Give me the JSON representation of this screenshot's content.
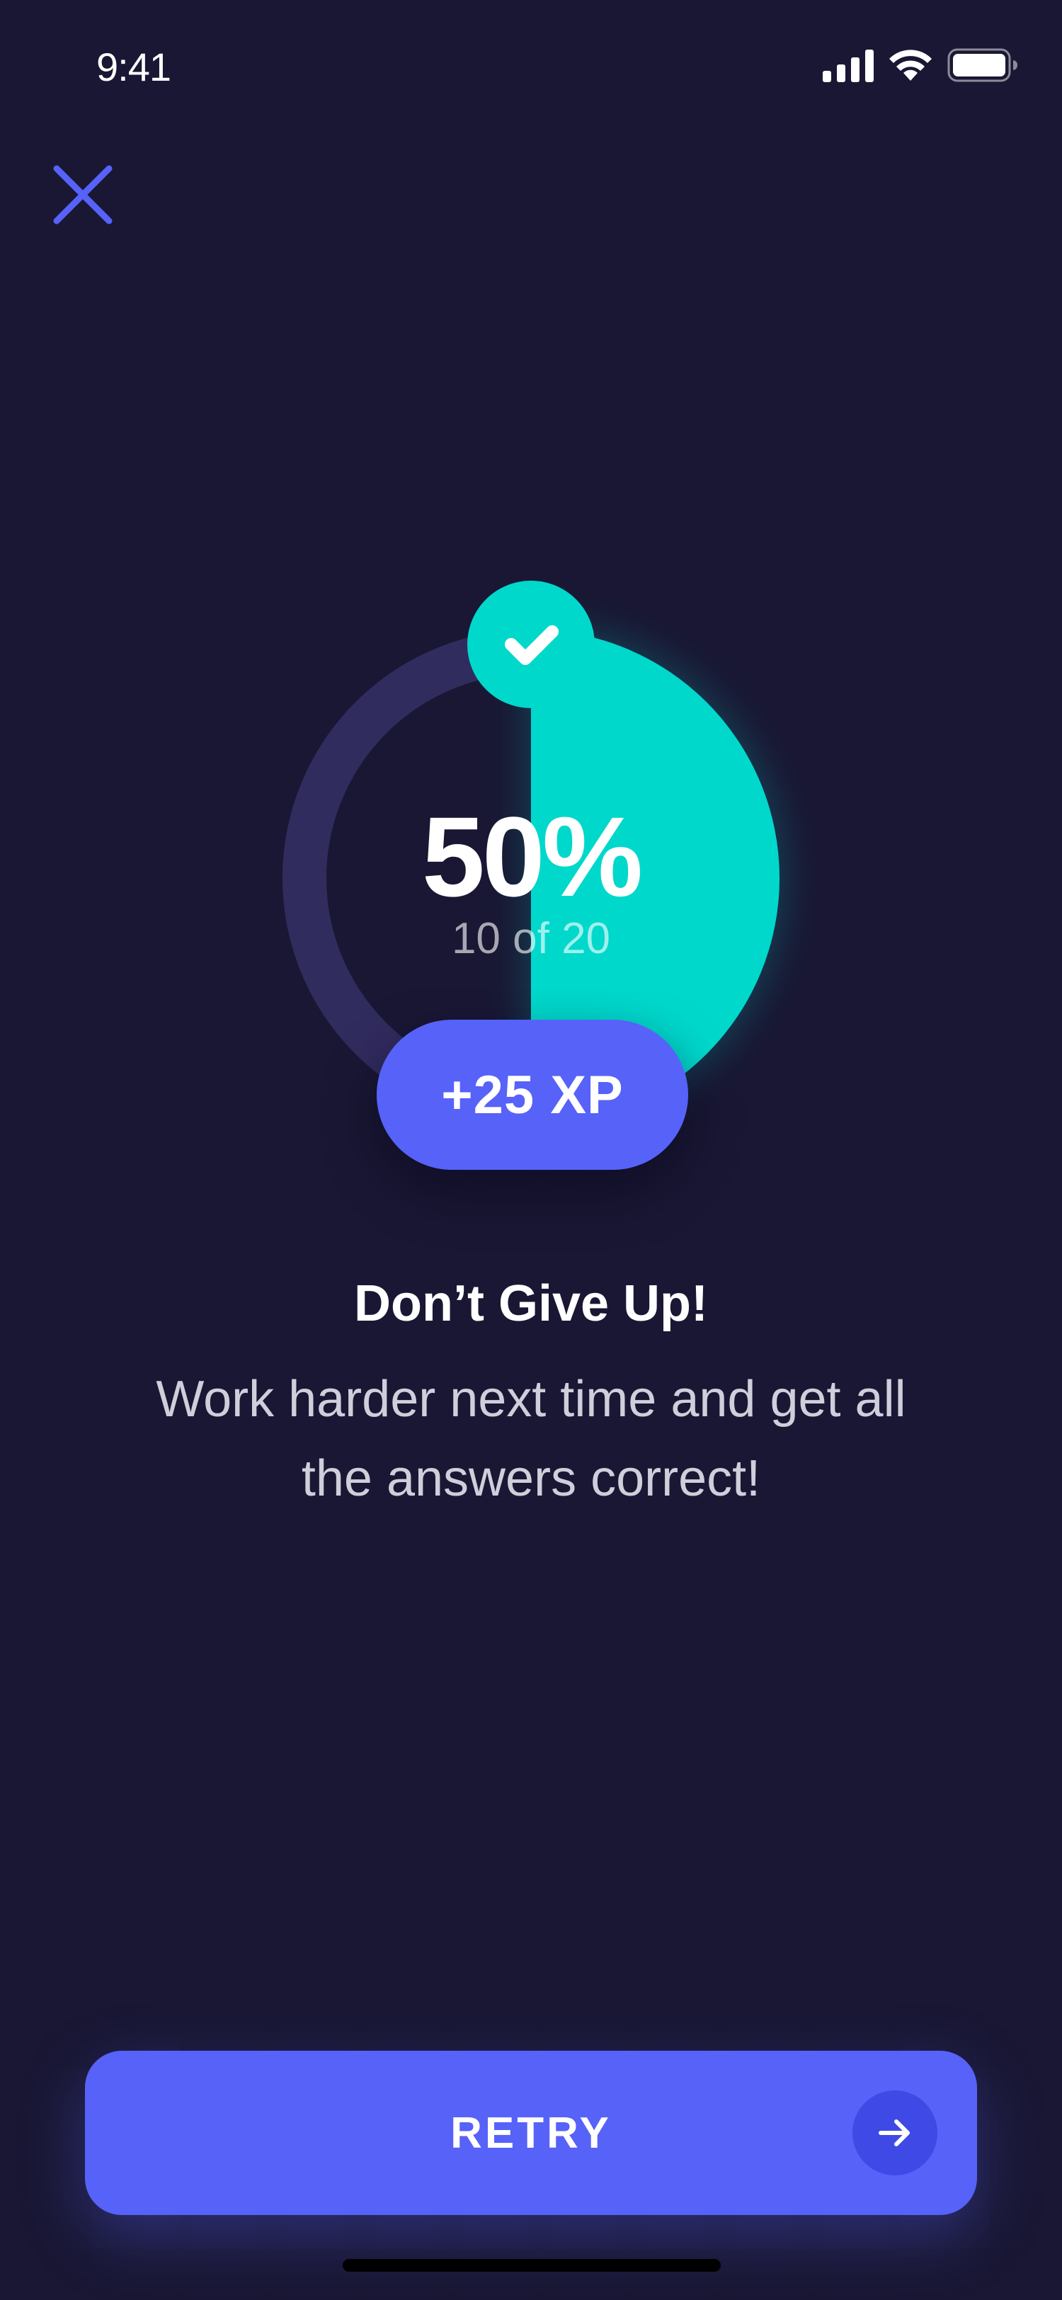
{
  "status_bar": {
    "time": "9:41"
  },
  "toolbar": {
    "close_icon": "close-icon"
  },
  "result": {
    "progress_fraction": 0.5,
    "percent_label": "50%",
    "score_label": "10 of 20",
    "xp_label": "+25 XP",
    "status_icon": "check-icon"
  },
  "feedback": {
    "heading": "Don’t Give Up!",
    "message": "Work harder next time and get all the answers correct!"
  },
  "actions": {
    "retry_label": "RETRY",
    "retry_icon": "arrow-right-icon"
  },
  "colors": {
    "background": "#191733",
    "track": "#312c5e",
    "progress": "#00d8cc",
    "accent": "#5762f9",
    "text_primary": "#ffffff",
    "text_secondary": "#cfcfdc"
  }
}
